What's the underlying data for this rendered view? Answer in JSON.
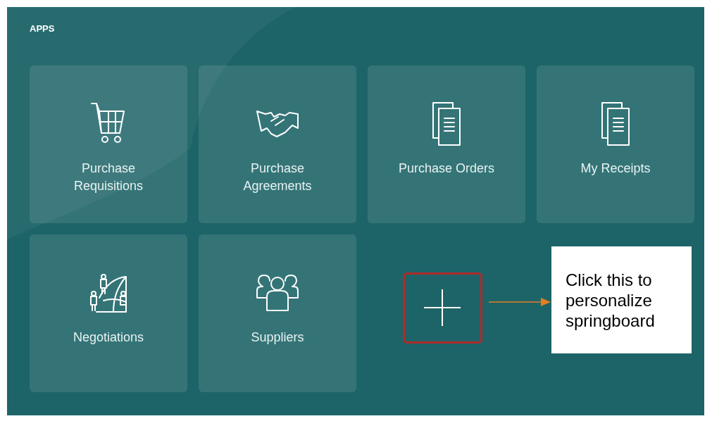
{
  "header": {
    "title": "APPS"
  },
  "tiles": [
    {
      "label": "Purchase Requisitions",
      "kind": "cart"
    },
    {
      "label": "Purchase Agreements",
      "kind": "handshake"
    },
    {
      "label": "Purchase Orders",
      "kind": "document"
    },
    {
      "label": "My Receipts",
      "kind": "document"
    },
    {
      "label": "Negotiations",
      "kind": "globe"
    },
    {
      "label": "Suppliers",
      "kind": "people"
    }
  ],
  "add_tile": {
    "highlighted": true
  },
  "annotation": {
    "text": "Click this to personalize springboard"
  }
}
